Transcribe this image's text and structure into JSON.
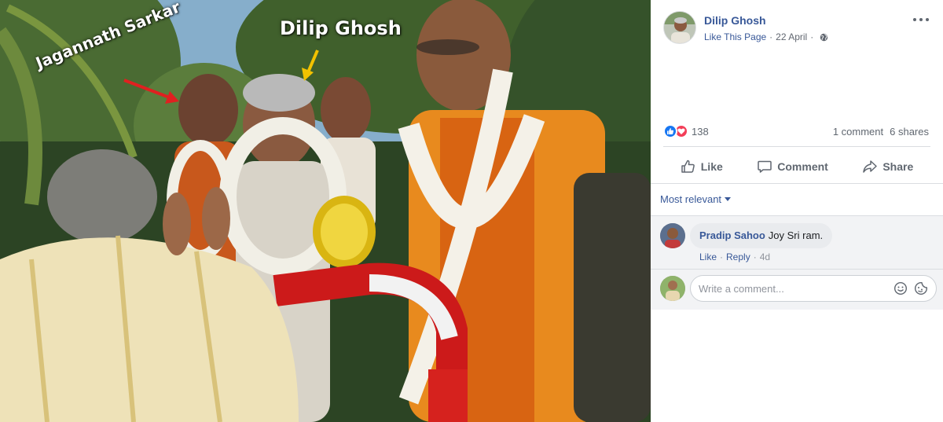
{
  "photo": {
    "labels": {
      "jagannath": "Jagannath Sarkar",
      "dilip": "Dilip Ghosh"
    },
    "arrow_colors": {
      "red": "#e02020",
      "yellow": "#f2c200"
    }
  },
  "post": {
    "page_name": "Dilip Ghosh",
    "like_page": "Like This Page",
    "date": "22 April",
    "privacy_icon": "globe-icon",
    "more_icon": "more-icon"
  },
  "reactions": {
    "count": "138",
    "icons": [
      "like-icon",
      "love-icon"
    ],
    "comments": "1 comment",
    "shares": "6 shares"
  },
  "actions": {
    "like": "Like",
    "comment": "Comment",
    "share": "Share"
  },
  "sort": {
    "label": "Most relevant"
  },
  "comments": [
    {
      "author": "Pradip Sahoo",
      "text": "Joy Sri ram.",
      "like": "Like",
      "reply": "Reply",
      "time": "4d"
    }
  ],
  "composer": {
    "placeholder": "Write a comment...",
    "icons": [
      "emoji-icon",
      "sticker-icon"
    ]
  },
  "colors": {
    "link": "#385898",
    "meta": "#616770",
    "like_blue": "#1877f2",
    "love_red": "#f33e58",
    "comment_bg": "#f2f3f5"
  }
}
